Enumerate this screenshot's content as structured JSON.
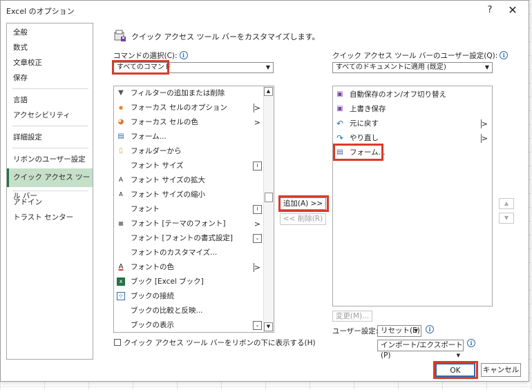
{
  "window": {
    "title": "Excel のオプション",
    "help": "?",
    "close": "✕"
  },
  "nav": {
    "items": [
      {
        "label": "全般"
      },
      {
        "label": "数式"
      },
      {
        "label": "文章校正"
      },
      {
        "label": "保存"
      },
      {
        "label": "言語"
      },
      {
        "label": "アクセシビリティ"
      },
      {
        "label": "詳細設定"
      },
      {
        "label": "リボンのユーザー設定"
      },
      {
        "label": "クイック アクセス ツール バー",
        "selected": true
      },
      {
        "label": "アドイン"
      },
      {
        "label": "トラスト センター"
      }
    ]
  },
  "header": {
    "text": "クイック アクセス ツール バーをカスタマイズします。"
  },
  "commands": {
    "label": "コマンドの選択(C):",
    "selected": "すべてのコマンド",
    "items": [
      {
        "icon": "▼",
        "label": "フィルターの追加または削除"
      },
      {
        "icon": "●",
        "label": "フォーカス セルのオプション",
        "sub": ">"
      },
      {
        "icon": "◕",
        "label": "フォーカス セルの色",
        "sub": ">"
      },
      {
        "icon": "▤",
        "label": "フォーム..."
      },
      {
        "icon": "▯",
        "label": "フォルダーから"
      },
      {
        "icon": "",
        "label": "フォント サイズ",
        "dd": "I"
      },
      {
        "icon": "A",
        "label": "フォント サイズの拡大"
      },
      {
        "icon": "A",
        "label": "フォント サイズの縮小"
      },
      {
        "icon": "",
        "label": "フォント",
        "dd": "I"
      },
      {
        "icon": "▦",
        "label": "フォント [テーマのフォント]",
        "sub": ">"
      },
      {
        "icon": "",
        "label": "フォント [フォントの書式設定]",
        "dd": "⌄"
      },
      {
        "icon": "",
        "label": "フォントのカスタマイズ..."
      },
      {
        "icon": "A",
        "label": "フォントの色",
        "sub": ">"
      },
      {
        "icon": "x",
        "label": "ブック [Excel ブック]"
      },
      {
        "icon": "⊹",
        "label": "ブックの接続"
      },
      {
        "icon": "",
        "label": "ブックの比較と反映..."
      },
      {
        "icon": "",
        "label": "ブックの表示",
        "dd": "⌄"
      }
    ],
    "show_below_checkbox": "クイック アクセス ツール バーをリボンの下に表示する(H)"
  },
  "buttons": {
    "add": "追加(A) >>",
    "remove": "<< 削除(R)"
  },
  "qat": {
    "label": "クイック アクセス ツール バーのユーザー設定(Q):",
    "selected": "すべてのドキュメントに適用 (既定)",
    "items": [
      {
        "icon": "▣",
        "label": "自動保存のオン/オフ切り替え"
      },
      {
        "icon": "▣",
        "label": "上書き保存"
      },
      {
        "icon": "↶",
        "label": "元に戻す",
        "sub": ">"
      },
      {
        "icon": "↷",
        "label": "やり直し",
        "sub": ">"
      },
      {
        "icon": "▤",
        "label": "フォーム..."
      }
    ],
    "modify": "変更(M)...",
    "user_settings_label": "ユーザー設定:",
    "reset": "リセット(E)",
    "import_export": "インポート/エクスポート(P)"
  },
  "footer": {
    "ok": "OK",
    "cancel": "キャンセル"
  },
  "colors": {
    "highlight": "#d83b2b",
    "nav_selected": "#c6dfc9",
    "excel_green": "#217346"
  }
}
